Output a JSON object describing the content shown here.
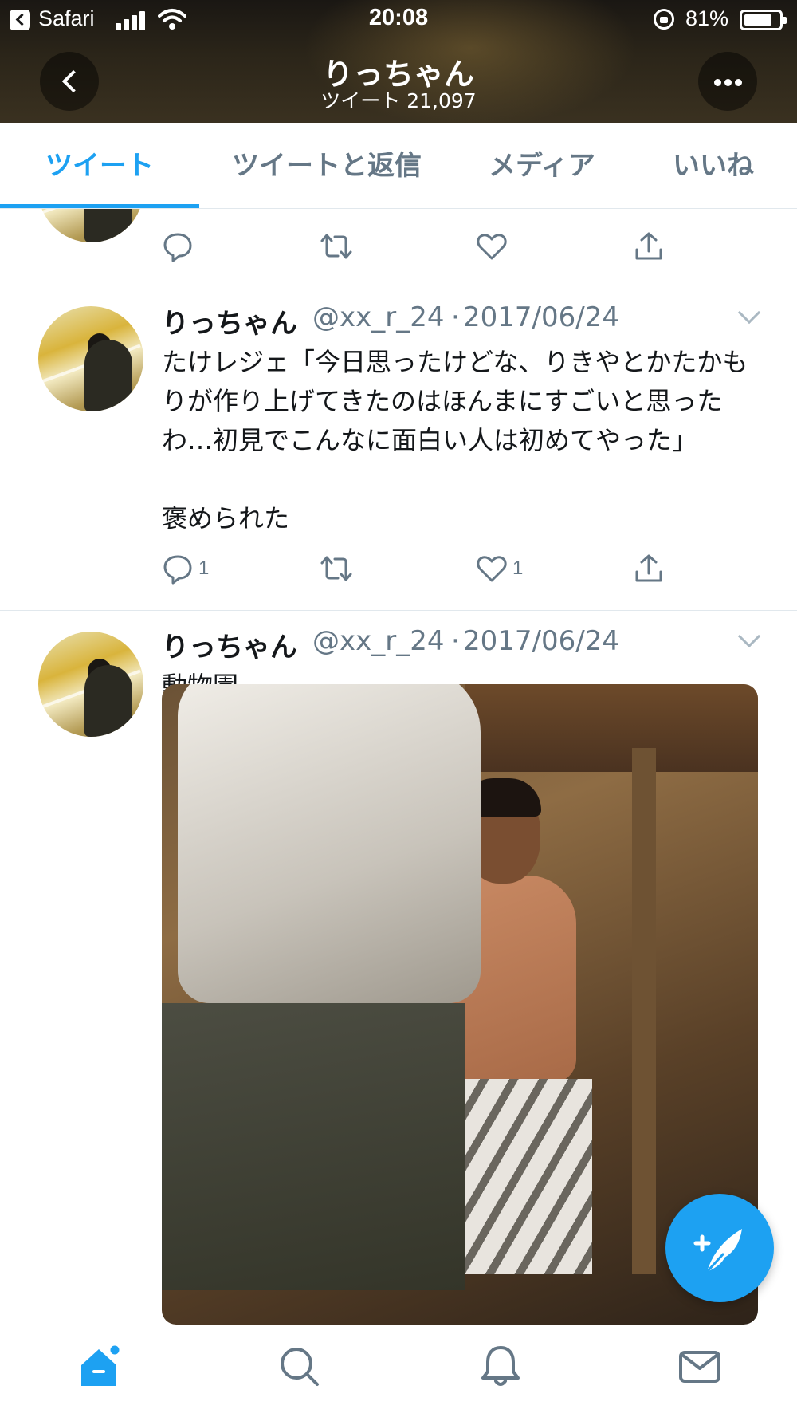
{
  "status_bar": {
    "app": "Safari",
    "time": "20:08",
    "battery_percent": "81%",
    "battery_level": 0.81
  },
  "profile_header": {
    "title": "りっちゃん",
    "subtitle": "ツイート 21,097"
  },
  "tabs": [
    {
      "label": "ツイート",
      "active": true
    },
    {
      "label": "ツイートと返信",
      "active": false
    },
    {
      "label": "メディア",
      "active": false
    },
    {
      "label": "いいね",
      "active": false
    }
  ],
  "tweets": [
    {
      "name": "りっちゃん",
      "handle": "@xx_r_24",
      "separator": "·",
      "date": "2017/06/24",
      "text": "たけレジェ「今日思ったけどな、りきやとかたかもりが作り上げてきたのはほんまにすごいと思ったわ…初見でこんなに面白い人は初めてやった」\n\n褒められた",
      "reply_count": "1",
      "like_count": "1"
    },
    {
      "name": "りっちゃん",
      "handle": "@xx_r_24",
      "separator": "·",
      "date": "2017/06/24",
      "text": "動物園"
    }
  ],
  "icons": {
    "reply": "reply-icon",
    "retweet": "retweet-icon",
    "like": "heart-icon",
    "share": "share-icon",
    "compose": "compose-tweet-icon",
    "home": "home-icon",
    "search": "search-icon",
    "notifications": "bell-icon",
    "messages": "mail-icon"
  },
  "colors": {
    "accent": "#1da1f2",
    "text": "#14171a",
    "secondary_text": "#657786",
    "divider": "#e1e8ed"
  }
}
